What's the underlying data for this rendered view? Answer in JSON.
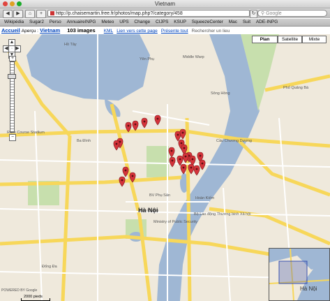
{
  "window": {
    "title": "Vietnam"
  },
  "toolbar": {
    "back": "◀",
    "forward": "▶",
    "home": "⌂",
    "add": "+",
    "url": "http://p.chaisemartin.free.fr/photos/map.php?/category/458",
    "reload": "↻",
    "search_placeholder": "Google"
  },
  "bookmarks": [
    "Wikipédia",
    "Sugar2",
    "Perso",
    "AnnuaireINPG",
    "Meteo",
    "UPS",
    "Change",
    "CIJPS",
    "KSUP",
    "SqueezeCenter",
    "Mac",
    "Suit",
    "ADE-INPG"
  ],
  "page": {
    "home_link": "Accueil",
    "overview_label": "Aperçu :",
    "category": "Vietnam",
    "count": "103 images",
    "kml": "KML",
    "link_page": "Lien vers cette page",
    "show_all": "Présente tout",
    "search_label": "Rechercher un lieu"
  },
  "map": {
    "types": [
      "Plan",
      "Satellite",
      "Mixte"
    ],
    "active_type": "Plan",
    "labels": [
      "Yên Phụ",
      "Middle Warp",
      "Bảo Khánh",
      "Hoàn Kiếm",
      "Ba Đình",
      "Hà Nội",
      "Hồ Tây",
      "Sông Hồng",
      "Đống Đa",
      "Ministry of Public Security",
      "Bộ Lao động Thương binh Xã hội",
      "BV Phụ Sản",
      "Phố Quảng Bá",
      "Cầu Chương Dương",
      "Race Course Stadium"
    ],
    "city": "Hà Nội",
    "overview_city": "Hà Nội",
    "powered_by": "POWERED BY Google",
    "scale": "2000 pieds",
    "markers": 24
  },
  "colors": {
    "marker": "#d4333a",
    "lake": "#9fb7d4",
    "road_major": "#f7d75a",
    "road_minor": "#ffffff",
    "park": "#c7dfad",
    "river": "#9fb7d4"
  }
}
